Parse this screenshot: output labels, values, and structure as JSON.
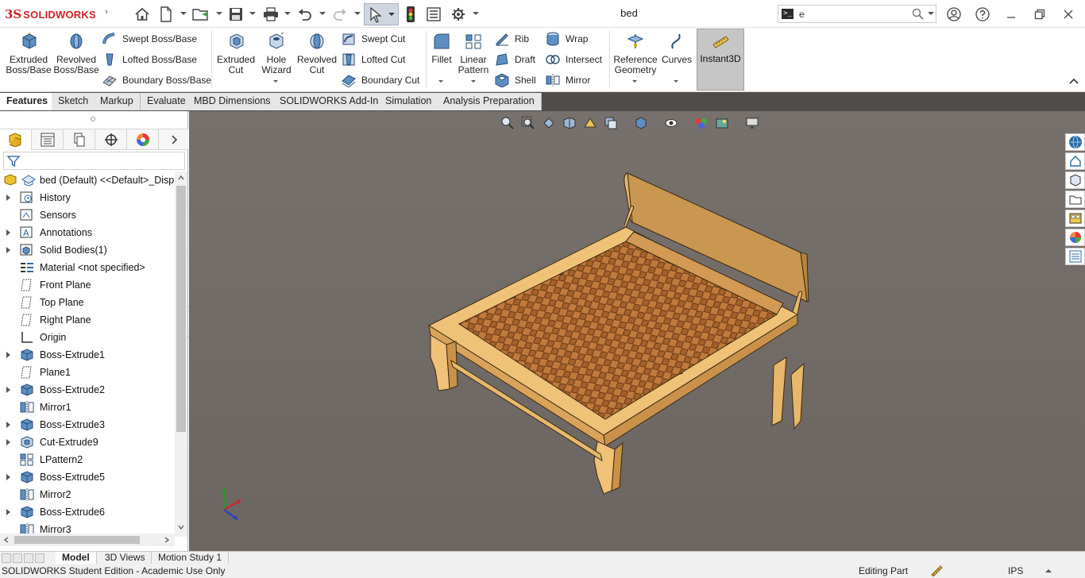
{
  "app": {
    "brand_prefix": "3S",
    "brand_name": "SOLIDWORKS",
    "document_title": "bed"
  },
  "search": {
    "value": "e",
    "icon": "command-prompt-icon"
  },
  "quick_access": [
    {
      "name": "home-icon"
    },
    {
      "name": "new-document-icon"
    },
    {
      "name": "open-icon"
    },
    {
      "name": "save-icon"
    },
    {
      "name": "print-icon"
    },
    {
      "name": "undo-icon"
    },
    {
      "name": "redo-icon"
    },
    {
      "name": "select-icon"
    },
    {
      "name": "rebuild-icon"
    },
    {
      "name": "file-properties-icon"
    },
    {
      "name": "options-icon"
    }
  ],
  "ribbon": {
    "extruded_boss": "Extruded\nBoss/Base",
    "revolved_boss": "Revolved\nBoss/Base",
    "swept_boss": "Swept Boss/Base",
    "lofted_boss": "Lofted Boss/Base",
    "boundary_boss": "Boundary Boss/Base",
    "extruded_cut": "Extruded\nCut",
    "hole_wizard": "Hole\nWizard",
    "revolved_cut": "Revolved\nCut",
    "swept_cut": "Swept Cut",
    "lofted_cut": "Lofted Cut",
    "boundary_cut": "Boundary Cut",
    "fillet": "Fillet",
    "linear_pattern": "Linear\nPattern",
    "rib": "Rib",
    "draft": "Draft",
    "shell": "Shell",
    "wrap": "Wrap",
    "intersect": "Intersect",
    "mirror": "Mirror",
    "reference_geometry": "Reference\nGeometry",
    "curves": "Curves",
    "instant3d": "Instant3D"
  },
  "tabs": [
    "Features",
    "Sketch",
    "Markup",
    "Evaluate",
    "MBD Dimensions",
    "SOLIDWORKS Add-Ins",
    "Simulation",
    "Analysis Preparation"
  ],
  "active_tab": "Features",
  "tree": {
    "root": "bed (Default) <<Default>_Displa",
    "items": [
      {
        "label": "History",
        "icon": "history-icon",
        "expandable": true
      },
      {
        "label": "Sensors",
        "icon": "sensors-icon",
        "expandable": false
      },
      {
        "label": "Annotations",
        "icon": "annotations-icon",
        "expandable": true
      },
      {
        "label": "Solid Bodies(1)",
        "icon": "solid-bodies-icon",
        "expandable": true
      },
      {
        "label": "Material <not specified>",
        "icon": "material-icon",
        "expandable": false
      },
      {
        "label": "Front Plane",
        "icon": "plane-icon",
        "expandable": false
      },
      {
        "label": "Top Plane",
        "icon": "plane-icon",
        "expandable": false
      },
      {
        "label": "Right Plane",
        "icon": "plane-icon",
        "expandable": false
      },
      {
        "label": "Origin",
        "icon": "origin-icon",
        "expandable": false
      },
      {
        "label": "Boss-Extrude1",
        "icon": "extrude-icon",
        "expandable": true
      },
      {
        "label": "Plane1",
        "icon": "plane-icon",
        "expandable": false
      },
      {
        "label": "Boss-Extrude2",
        "icon": "extrude-icon",
        "expandable": true
      },
      {
        "label": "Mirror1",
        "icon": "mirror-icon",
        "expandable": false
      },
      {
        "label": "Boss-Extrude3",
        "icon": "extrude-icon",
        "expandable": true
      },
      {
        "label": "Cut-Extrude9",
        "icon": "cut-extrude-icon",
        "expandable": true
      },
      {
        "label": "LPattern2",
        "icon": "linear-pattern-icon",
        "expandable": false
      },
      {
        "label": "Boss-Extrude5",
        "icon": "extrude-icon",
        "expandable": true
      },
      {
        "label": "Mirror2",
        "icon": "mirror-icon",
        "expandable": false
      },
      {
        "label": "Boss-Extrude6",
        "icon": "extrude-icon",
        "expandable": true
      },
      {
        "label": "Mirror3",
        "icon": "mirror-icon",
        "expandable": false
      }
    ]
  },
  "bottom_tabs": [
    "Model",
    "3D Views",
    "Motion Study 1"
  ],
  "active_bottom_tab": "Model",
  "status": {
    "left": "SOLIDWORKS Student Edition - Academic Use Only",
    "mode": "Editing Part",
    "units": "IPS"
  },
  "colors": {
    "brand_red": "#d12128",
    "viewport_bg": "#706a66",
    "wood": "#e9b867",
    "wood_dark": "#b9843a",
    "mattress": "#c07a3c"
  }
}
